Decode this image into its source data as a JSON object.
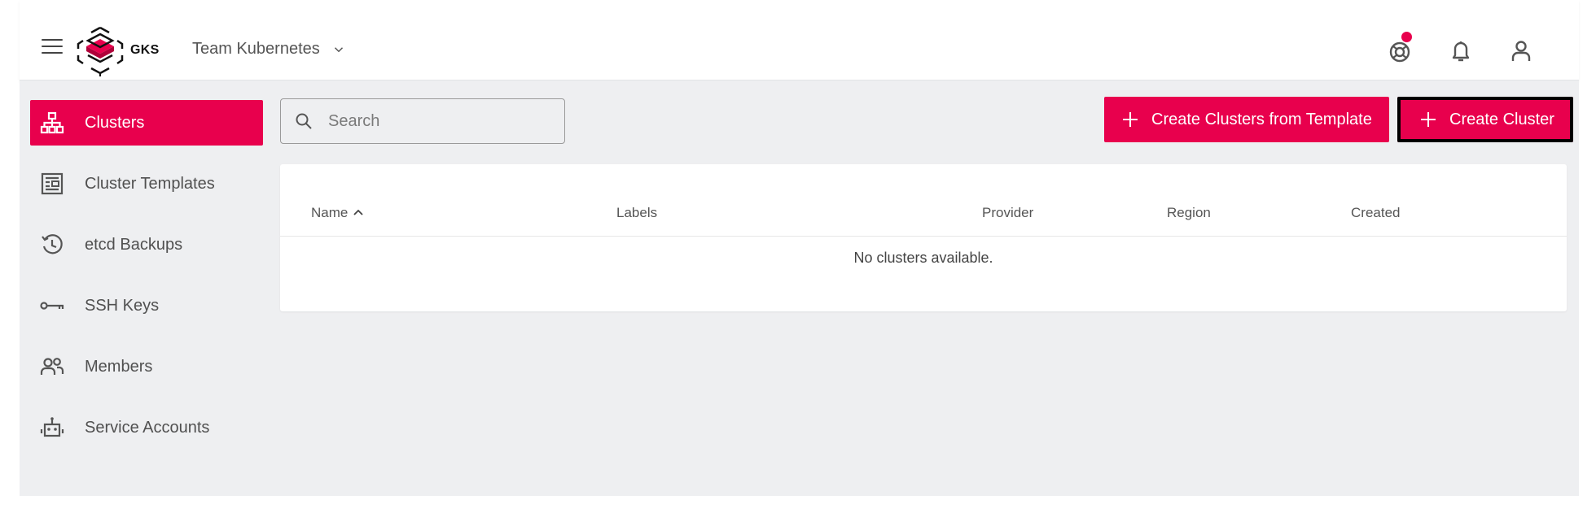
{
  "header": {
    "logo_text": "GKS",
    "project_name": "Team Kubernetes",
    "icons": [
      "menu-icon",
      "support-icon",
      "bell-icon",
      "user-icon"
    ],
    "accent_color": "#e8004d"
  },
  "sidebar": {
    "items": [
      {
        "label": "Clusters",
        "icon": "cluster-icon",
        "active": true
      },
      {
        "label": "Cluster Templates",
        "icon": "template-icon"
      },
      {
        "label": "etcd Backups",
        "icon": "history-icon"
      },
      {
        "label": "SSH Keys",
        "icon": "key-icon"
      },
      {
        "label": "Members",
        "icon": "members-icon"
      },
      {
        "label": "Service Accounts",
        "icon": "robot-icon"
      }
    ]
  },
  "toolbar": {
    "search_placeholder": "Search",
    "create_from_template_label": "Create Clusters from Template",
    "create_cluster_label": "Create Cluster"
  },
  "table": {
    "columns": [
      {
        "label": "Name",
        "sorted": "ascending"
      },
      {
        "label": "Labels"
      },
      {
        "label": "Provider"
      },
      {
        "label": "Region"
      },
      {
        "label": "Created"
      }
    ],
    "empty_message": "No clusters available."
  }
}
